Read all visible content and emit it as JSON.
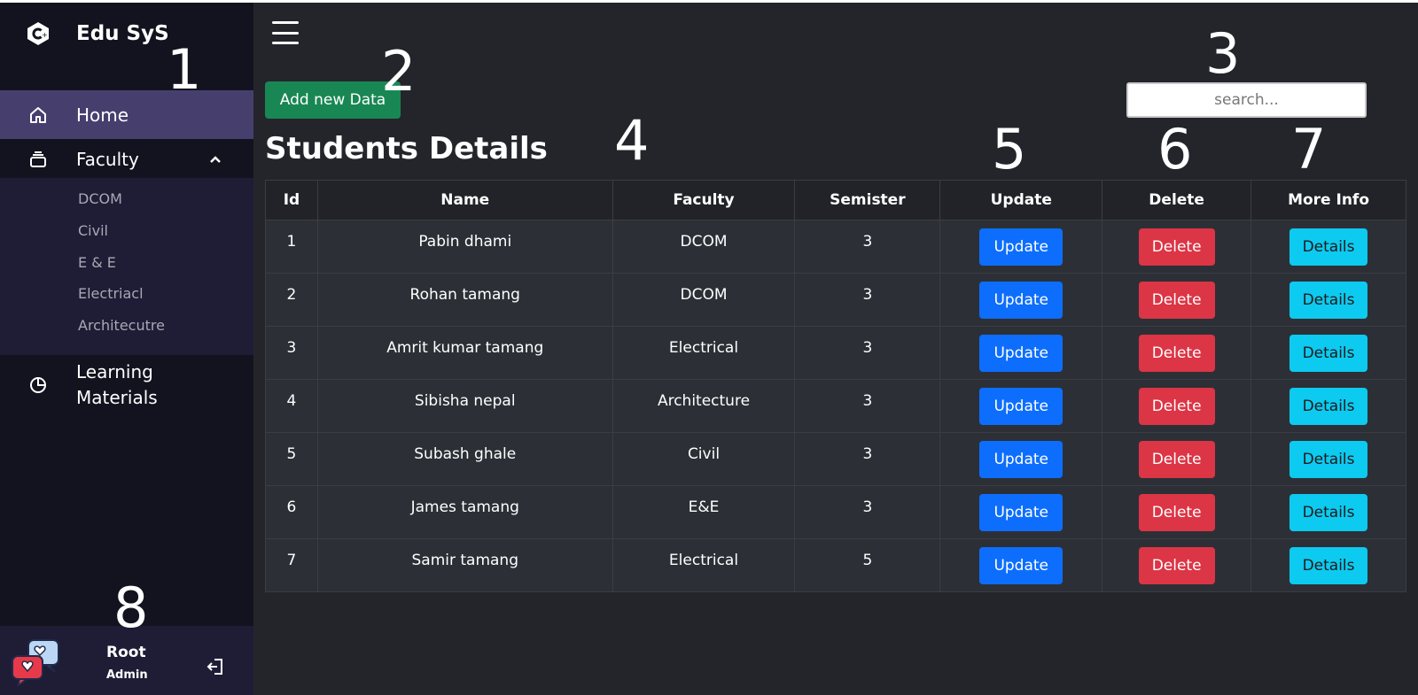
{
  "brand": {
    "name": "Edu SyS"
  },
  "sidebar": {
    "home": "Home",
    "faculty": "Faculty",
    "faculty_items": [
      "DCOM",
      "Civil",
      "E & E",
      "Electriacl",
      "Architecutre"
    ],
    "learning_line1": "Learning",
    "learning_line2": "Materials"
  },
  "user": {
    "name": "Root",
    "role": "Admin"
  },
  "toolbar": {
    "add_label": "Add new Data",
    "search_placeholder": "search..."
  },
  "page": {
    "title": "Students Details"
  },
  "table": {
    "headers": [
      "Id",
      "Name",
      "Faculty",
      "Semister",
      "Update",
      "Delete",
      "More Info"
    ],
    "update_label": "Update",
    "delete_label": "Delete",
    "details_label": "Details",
    "rows": [
      {
        "id": "1",
        "name": "Pabin dhami",
        "faculty": "DCOM",
        "semister": "3"
      },
      {
        "id": "2",
        "name": "Rohan tamang",
        "faculty": "DCOM",
        "semister": "3"
      },
      {
        "id": "3",
        "name": "Amrit kumar tamang",
        "faculty": "Electrical",
        "semister": "3"
      },
      {
        "id": "4",
        "name": "Sibisha nepal",
        "faculty": "Architecture",
        "semister": "3"
      },
      {
        "id": "5",
        "name": "Subash ghale",
        "faculty": "Civil",
        "semister": "3"
      },
      {
        "id": "6",
        "name": "James tamang",
        "faculty": "E&E",
        "semister": "3"
      },
      {
        "id": "7",
        "name": "Samir tamang",
        "faculty": "Electrical",
        "semister": "5"
      }
    ]
  },
  "markers": [
    "1",
    "2",
    "3",
    "4",
    "5",
    "6",
    "7",
    "8"
  ],
  "colors": {
    "sidebar_bg": "#13131f",
    "active_item": "#463f6e",
    "submenu_bg": "#1f1c35",
    "main_bg": "#23252b",
    "add_btn": "#198754",
    "update_btn": "#0d6efd",
    "delete_btn": "#dc3545",
    "details_btn": "#0dcaf0"
  },
  "icons": [
    "brand-logo-icon",
    "home-icon",
    "stack-icon",
    "chevron-up-icon",
    "pie-chart-icon",
    "logout-icon",
    "menu-icon",
    "avatar-chat-icon"
  ]
}
